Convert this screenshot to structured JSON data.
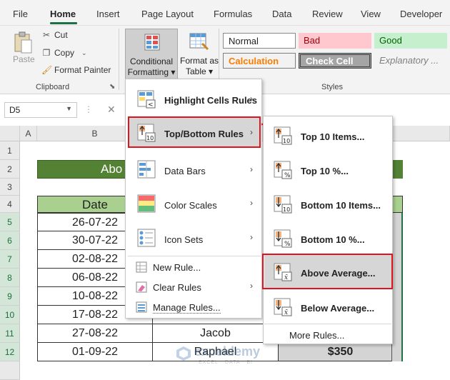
{
  "tabs": [
    "File",
    "Home",
    "Insert",
    "Page Layout",
    "Formulas",
    "Data",
    "Review",
    "View",
    "Developer"
  ],
  "clipboard": {
    "paste": "Paste",
    "cut": "Cut",
    "copy": "Copy",
    "format_painter": "Format Painter",
    "group_label": "Clipboard"
  },
  "cond_formatting": {
    "line1": "Conditional",
    "line2": "Formatting ▾"
  },
  "format_table": {
    "line1": "Format as",
    "line2": "Table ▾"
  },
  "styles": {
    "normal": "Normal",
    "bad": "Bad",
    "good": "Good",
    "calculation": "Calculation",
    "check_cell": "Check Cell",
    "explanatory": "Explanatory ...",
    "group_label": "Styles"
  },
  "name_box": "D5",
  "formula_cancel": "✕",
  "columns": [
    "A",
    "B"
  ],
  "rows": [
    "1",
    "2",
    "3",
    "4",
    "5",
    "6",
    "7",
    "8",
    "9",
    "10",
    "11",
    "12"
  ],
  "sheet": {
    "title_fragment": "Abo",
    "date_header": "Date",
    "dates": [
      "26-07-22",
      "30-07-22",
      "02-08-22",
      "06-08-22",
      "10-08-22",
      "17-08-22",
      "27-08-22",
      "01-09-22"
    ],
    "name_row11": "Jacob",
    "name_row12": "Raphael",
    "value_row12": "$350"
  },
  "cf_menu": {
    "highlight": "Highlight Cells Rules",
    "topbottom": "Top/Bottom Rules",
    "databars": "Data Bars",
    "colorscales": "Color Scales",
    "iconsets": "Icon Sets",
    "newrule": "New Rule...",
    "clearrules": "Clear Rules",
    "managerules": "Manage Rules..."
  },
  "tb_menu": {
    "top10": "Top 10 Items...",
    "top10pct": "Top 10 %...",
    "bottom10": "Bottom 10 Items...",
    "bottom10pct": "Bottom 10 %...",
    "above_avg": "Above Average...",
    "below_avg": "Below Average...",
    "more_rules": "More Rules..."
  },
  "icon_labels": {
    "num10": "10",
    "pct": "%",
    "xbar": "x̄"
  },
  "watermark": {
    "name": "exceldemy",
    "tagline": "EXCEL · DATA · BI"
  },
  "colors": {
    "accent": "#1e7145",
    "highlight_red": "#e0141e",
    "title_green": "#548235",
    "header_green": "#a9d08e",
    "bad_bg": "#ffc7ce",
    "good_bg": "#c6efce",
    "calc_orange": "#fa7d00",
    "check_cell_bg": "#a5a5a5"
  }
}
